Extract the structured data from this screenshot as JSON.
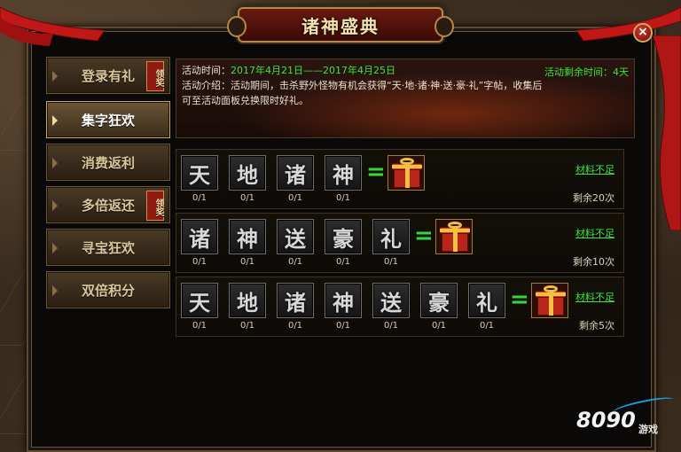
{
  "window": {
    "title": "诸神盛典"
  },
  "sidebar": {
    "items": [
      {
        "label": "登录有礼",
        "badge": "领奖",
        "active": false
      },
      {
        "label": "集字狂欢",
        "badge": "",
        "active": true
      },
      {
        "label": "消费返利",
        "badge": "",
        "active": false
      },
      {
        "label": "多倍返还",
        "badge": "领奖",
        "active": false
      },
      {
        "label": "寻宝狂欢",
        "badge": "",
        "active": false
      },
      {
        "label": "双倍积分",
        "badge": "",
        "active": false
      }
    ]
  },
  "banner": {
    "time_label": "活动时间：",
    "time_value": "2017年4月21日——2017年4月25日",
    "remain_label": "活动剩余时间：",
    "remain_value": "4天",
    "intro_line1": "活动介绍：活动期间，击杀野外怪物有机会获得“天·地·诸·神·送·豪·礼”字帖，收集后",
    "intro_line2": "可至活动面板兑换限时好礼。"
  },
  "rows": [
    {
      "chars": [
        "天",
        "地",
        "诸",
        "神"
      ],
      "counts": [
        "0/1",
        "0/1",
        "0/1",
        "0/1"
      ],
      "equals": "=",
      "status": "材料不足",
      "remaining": "剩余20次"
    },
    {
      "chars": [
        "诸",
        "神",
        "送",
        "豪",
        "礼"
      ],
      "counts": [
        "0/1",
        "0/1",
        "0/1",
        "0/1",
        "0/1"
      ],
      "equals": "=",
      "status": "材料不足",
      "remaining": "剩余10次"
    },
    {
      "chars": [
        "天",
        "地",
        "诸",
        "神",
        "送",
        "豪",
        "礼"
      ],
      "counts": [
        "0/1",
        "0/1",
        "0/1",
        "0/1",
        "0/1",
        "0/1",
        "0/1"
      ],
      "equals": "=",
      "status": "材料不足",
      "remaining": "剩余5次"
    }
  ],
  "close_glyph": "×",
  "watermark": {
    "brand": "8090",
    "suffix": "游戏"
  },
  "colors": {
    "accent_green": "#3fe23f",
    "title_gold": "#f4e1b0",
    "ribbon_red": "#c01818"
  }
}
